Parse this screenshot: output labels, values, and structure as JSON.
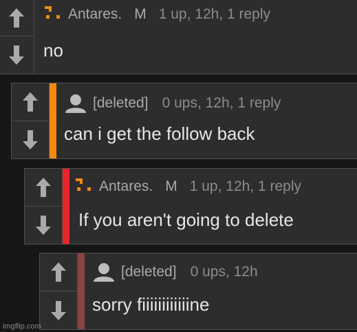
{
  "comments": [
    {
      "username": "Antares.",
      "flair": "M",
      "meta": "1 up, 12h, 1 reply",
      "body": "no",
      "accent_color": null,
      "user_icon": "orange-dots-icon"
    },
    {
      "username": "[deleted]",
      "meta": "0 ups, 12h, 1 reply",
      "body": "can i get the follow back",
      "accent_color": "#f5890f",
      "user_icon": "default-avatar-icon"
    },
    {
      "username": "Antares.",
      "flair": "M",
      "meta": "1 up, 12h, 1 reply",
      "body": "If you aren't going to delete",
      "accent_color": "#e8252b",
      "user_icon": "orange-dots-icon"
    },
    {
      "username": "[deleted]",
      "meta": "0 ups, 12h",
      "body": "sorry fiiiiiiiiiiiine",
      "accent_color": "#8a4343",
      "user_icon": "default-avatar-icon"
    }
  ],
  "watermark": "imgflip.com",
  "colors": {
    "background": "#161616",
    "card": "#2d2d2d",
    "border": "#505050",
    "icon_orange": "#f28a14"
  }
}
